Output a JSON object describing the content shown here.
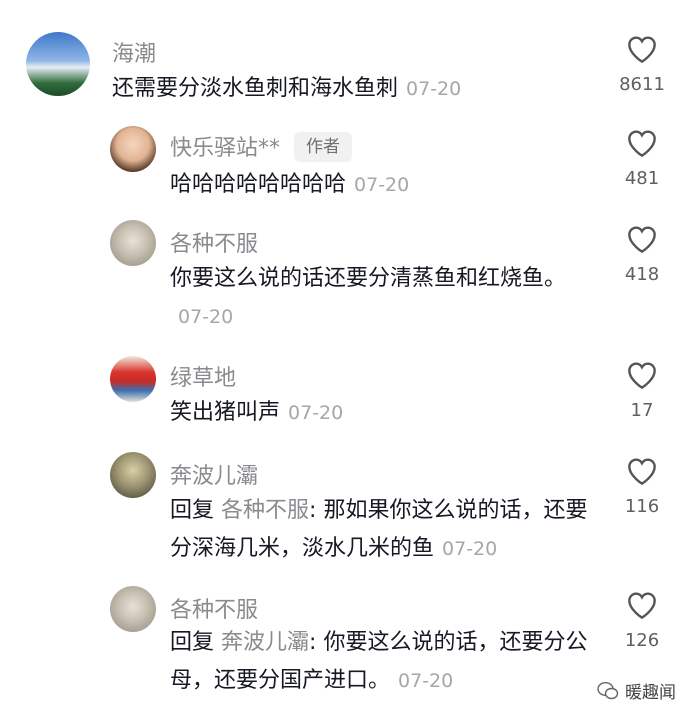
{
  "comments": [
    {
      "user": "海潮",
      "badge": "",
      "text": "还需要分淡水鱼刺和海水鱼刺",
      "reply_to": "",
      "date": "07-20",
      "likes": "8611"
    },
    {
      "user": "快乐驿站**",
      "badge": "作者",
      "text": "哈哈哈哈哈哈哈哈",
      "reply_to": "",
      "date": "07-20",
      "likes": "481"
    },
    {
      "user": "各种不服",
      "badge": "",
      "text": "你要这么说的话还要分清蒸鱼和红烧鱼。",
      "reply_to": "",
      "date": "07-20",
      "likes": "418"
    },
    {
      "user": "绿草地",
      "badge": "",
      "text": "笑出猪叫声",
      "reply_to": "",
      "date": "07-20",
      "likes": "17"
    },
    {
      "user": "奔波儿灞",
      "badge": "",
      "text": "那如果你这么说的话，还要分深海几米，淡水几米的鱼",
      "reply_to": "各种不服",
      "date": "07-20",
      "likes": "116"
    },
    {
      "user": "各种不服",
      "badge": "",
      "text": "你要这么说的话，还要分公母，还要分国产进口。",
      "reply_to": "奔波儿灞",
      "date": "07-20",
      "likes": "126"
    }
  ],
  "labels": {
    "reply_prefix": "回复"
  },
  "watermark": "暖趣闻"
}
